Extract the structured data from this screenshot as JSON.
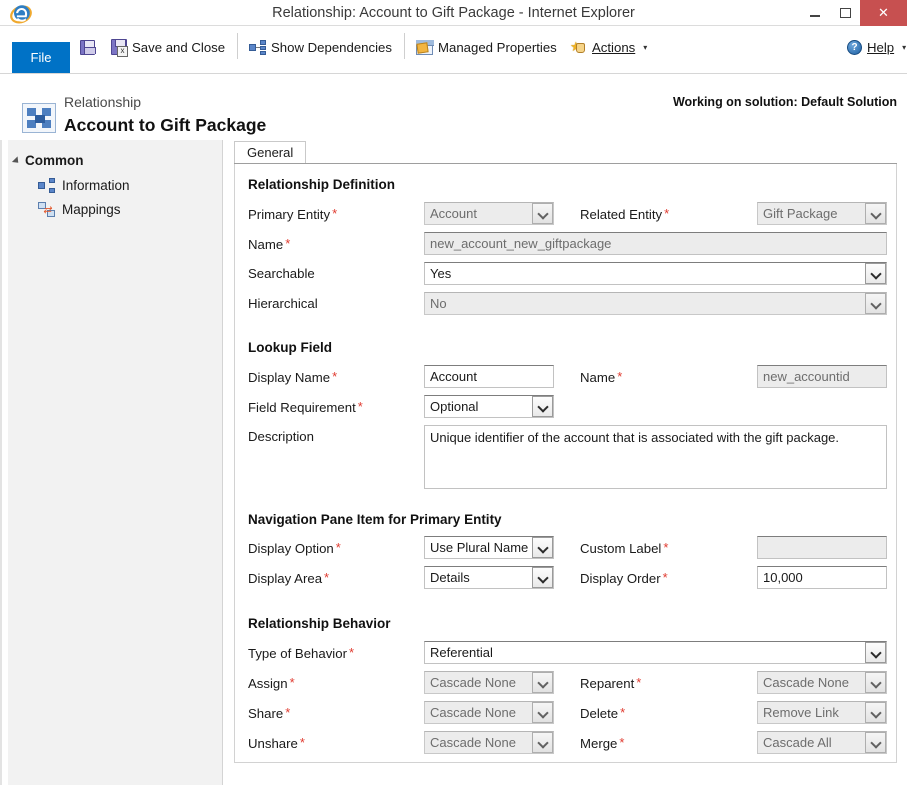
{
  "window": {
    "title": "Relationship: Account to Gift Package - Internet Explorer",
    "browser_icon": "internet-explorer-icon",
    "minimize": "–",
    "maximize": "☐",
    "close": "✕"
  },
  "ribbon": {
    "file_label": "File",
    "items": [
      {
        "label": "Save",
        "icon": "save-icon"
      },
      {
        "label": "Save and Close",
        "icon": "save-and-close-icon"
      },
      {
        "label": "Show Dependencies",
        "icon": "dependencies-icon"
      },
      {
        "label": "Managed Properties",
        "icon": "managed-properties-icon"
      },
      {
        "label": "Actions",
        "icon": "actions-icon",
        "caret": "▾"
      }
    ],
    "help_label": "Help",
    "help_caret": "▾",
    "help_icon": "help-icon"
  },
  "header": {
    "kicker": "Relationship",
    "title": "Account to Gift Package",
    "solution_note": "Working on solution: Default Solution",
    "icon": "relationship-icon"
  },
  "sidebar": {
    "group_label": "Common",
    "items": [
      {
        "label": "Information",
        "icon": "information-icon"
      },
      {
        "label": "Mappings",
        "icon": "mappings-icon"
      }
    ]
  },
  "tabs": [
    {
      "label": "General",
      "active": true
    }
  ],
  "form": {
    "sections": [
      {
        "title": "Relationship Definition",
        "fields": {
          "primary_entity_label": "Primary Entity",
          "primary_entity_value": "Account",
          "related_entity_label": "Related Entity",
          "related_entity_value": "Gift Package",
          "name_label": "Name",
          "name_value": "new_account_new_giftpackage",
          "searchable_label": "Searchable",
          "searchable_value": "Yes",
          "hierarchical_label": "Hierarchical",
          "hierarchical_value": "No"
        }
      },
      {
        "title": "Lookup Field",
        "fields": {
          "display_name_label": "Display Name",
          "display_name_value": "Account",
          "name_label": "Name",
          "name_value": "new_accountid",
          "field_requirement_label": "Field Requirement",
          "field_requirement_value": "Optional",
          "description_label": "Description",
          "description_value": "Unique identifier of the account that is associated with the gift package."
        }
      },
      {
        "title": "Navigation Pane Item for Primary Entity",
        "fields": {
          "display_option_label": "Display Option",
          "display_option_value": "Use Plural Name",
          "custom_label_label": "Custom Label",
          "custom_label_value": "",
          "display_area_label": "Display Area",
          "display_area_value": "Details",
          "display_order_label": "Display Order",
          "display_order_value": "10,000"
        }
      },
      {
        "title": "Relationship Behavior",
        "fields": {
          "type_of_behavior_label": "Type of Behavior",
          "type_of_behavior_value": "Referential",
          "assign_label": "Assign",
          "assign_value": "Cascade None",
          "reparent_label": "Reparent",
          "reparent_value": "Cascade None",
          "share_label": "Share",
          "share_value": "Cascade None",
          "delete_label": "Delete",
          "delete_value": "Remove Link",
          "unshare_label": "Unshare",
          "unshare_value": "Cascade None",
          "merge_label": "Merge",
          "merge_value": "Cascade All"
        }
      }
    ],
    "required_marker": "*"
  },
  "colors": {
    "accent": "#0072c6",
    "close_button": "#c75050",
    "required": "#e03a2f"
  }
}
